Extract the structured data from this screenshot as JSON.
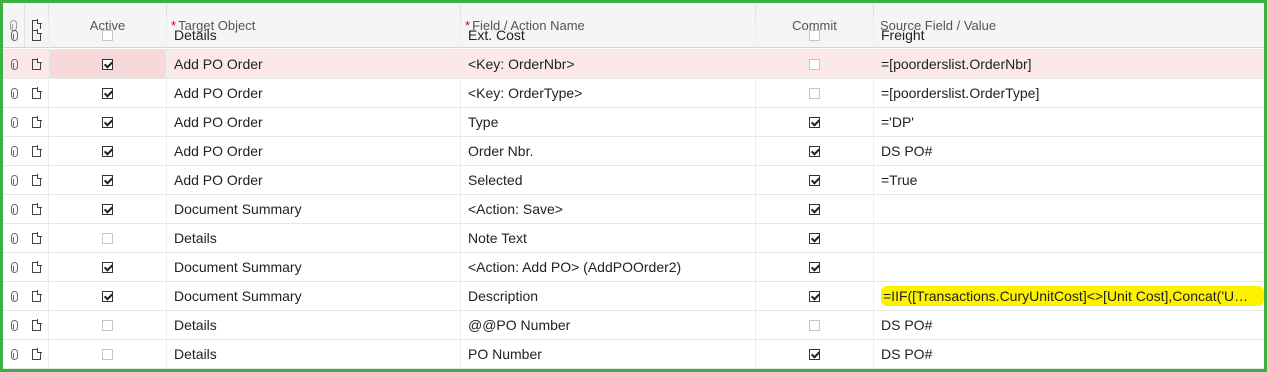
{
  "columns": {
    "active": "Active",
    "target": "Target Object",
    "field": "Field / Action Name",
    "commit": "Commit",
    "source": "Source Field / Value",
    "required_mark": "*"
  },
  "rows": [
    {
      "active": false,
      "target": "Details",
      "field": "Ext. Cost",
      "commit": false,
      "source": "Freight"
    },
    {
      "active": true,
      "target": "Add PO Order",
      "field": "<Key: OrderNbr>",
      "commit": false,
      "source": "=[poorderslist.OrderNbr]",
      "selected": true
    },
    {
      "active": true,
      "target": "Add PO Order",
      "field": "<Key: OrderType>",
      "commit": false,
      "source": "=[poorderslist.OrderType]"
    },
    {
      "active": true,
      "target": "Add PO Order",
      "field": "Type",
      "commit": true,
      "source": "='DP'"
    },
    {
      "active": true,
      "target": "Add PO Order",
      "field": "Order Nbr.",
      "commit": true,
      "source": "DS PO#"
    },
    {
      "active": true,
      "target": "Add PO Order",
      "field": "Selected",
      "commit": true,
      "source": "=True"
    },
    {
      "active": true,
      "target": "Document Summary",
      "field": "<Action: Save>",
      "commit": true,
      "source": ""
    },
    {
      "active": false,
      "target": "Details",
      "field": "Note Text",
      "commit": true,
      "source": ""
    },
    {
      "active": true,
      "target": "Document Summary",
      "field": "<Action: Add PO> (AddPOOrder2)",
      "commit": true,
      "source": ""
    },
    {
      "active": true,
      "target": "Document Summary",
      "field": "Description",
      "commit": true,
      "source": "=IIF([Transactions.CuryUnitCost]<>[Unit Cost],Concat('Unit Co...",
      "highlight": true
    },
    {
      "active": false,
      "target": "Details",
      "field": "@@PO Number",
      "commit": false,
      "source": "DS PO#"
    },
    {
      "active": false,
      "target": "Details",
      "field": "PO Number",
      "commit": true,
      "source": "DS PO#"
    }
  ],
  "colors": {
    "frame": "#3cb043",
    "selected_row": "#fbe8e8",
    "highlight": "#fff200",
    "required": "#d0021b"
  }
}
